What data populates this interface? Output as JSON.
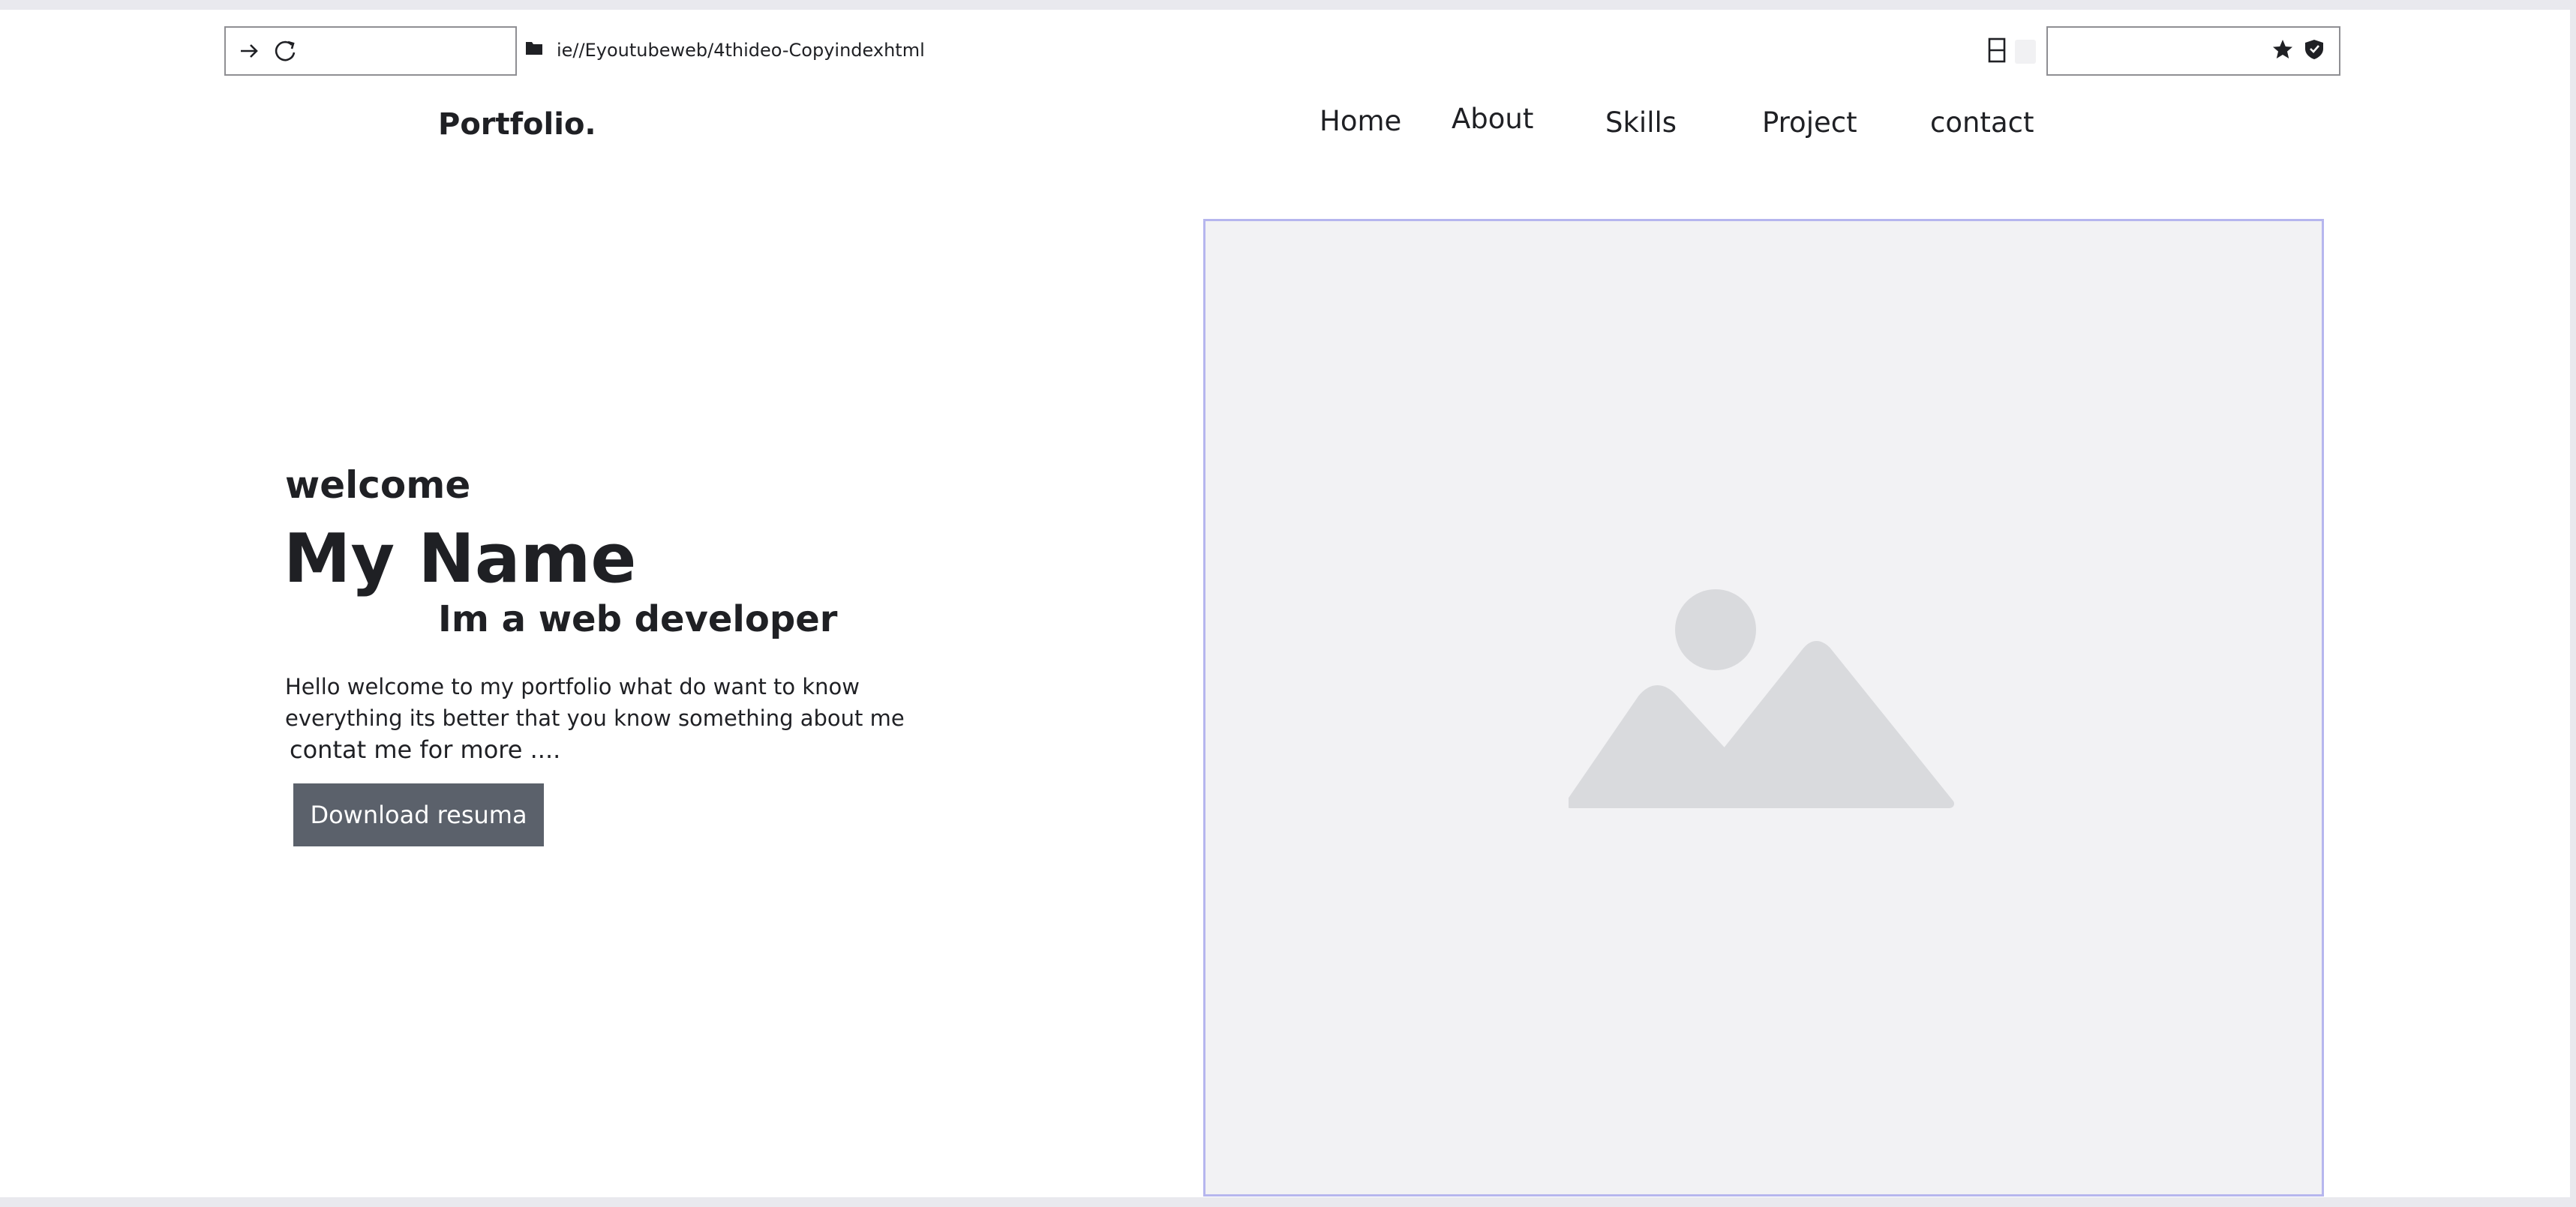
{
  "browser": {
    "url": "ie//Eyoutubeweb/4thideo-Copyindexhtml",
    "icons": [
      "arrow-right-icon",
      "refresh-icon",
      "folder-icon",
      "bookmark-panel-icon",
      "star-icon",
      "shield-icon"
    ]
  },
  "header": {
    "logo": "Portfolio.",
    "nav": [
      {
        "label": "Home"
      },
      {
        "label": "About"
      },
      {
        "label": "Skills"
      },
      {
        "label": "Project"
      },
      {
        "label": "contact"
      }
    ]
  },
  "hero": {
    "welcome": "welcome",
    "name": "My Name",
    "role": "Im a web developer",
    "description": "Hello welcome to my portfolio what do want to know everything its better that you know something about me",
    "more": "contat me for more ....",
    "button_label": "Download resuma",
    "image_icon": "image-placeholder-icon"
  },
  "colors": {
    "button_bg": "#5b616b",
    "image_border": "#b6b6ee",
    "image_bg": "#f2f2f4",
    "text": "#1f2024"
  }
}
